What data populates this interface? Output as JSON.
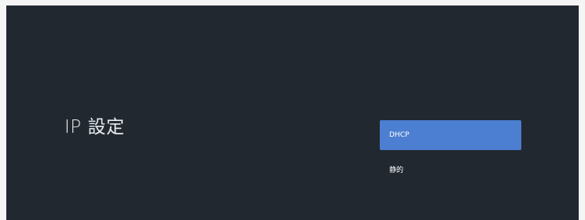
{
  "page": {
    "title": "IP 設定"
  },
  "options": [
    {
      "label": "DHCP",
      "selected": true
    },
    {
      "label": "静的",
      "selected": false
    }
  ],
  "colors": {
    "background": "#212830",
    "selection": "#4c7fd1",
    "text": "#ffffff"
  }
}
